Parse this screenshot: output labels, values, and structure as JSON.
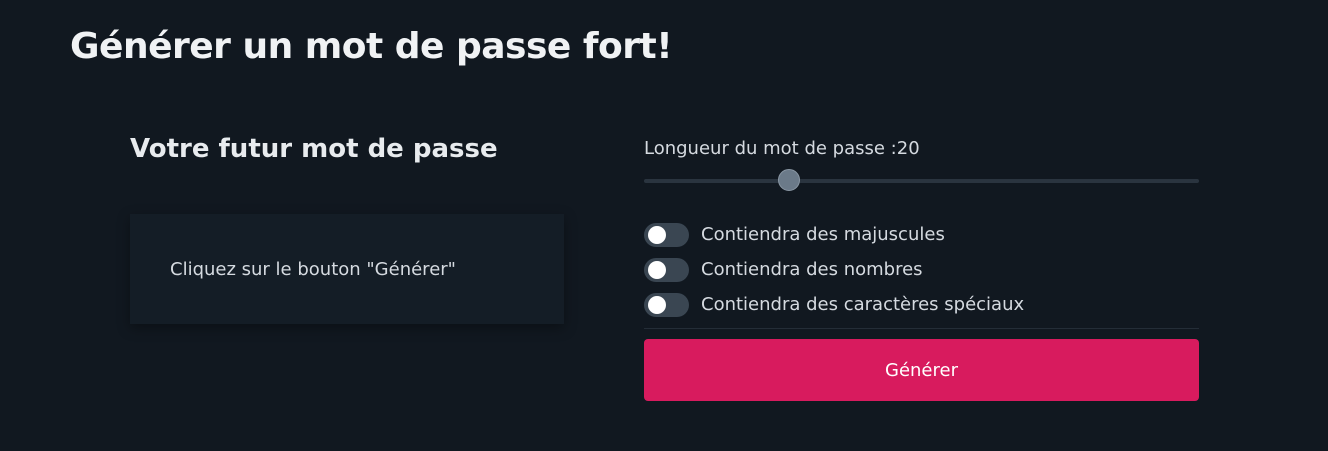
{
  "page": {
    "title": "Générer un mot de passe fort!"
  },
  "output": {
    "heading": "Votre futur mot de passe",
    "text": "Cliquez sur le bouton \"Générer\""
  },
  "options": {
    "length_label": "Longueur du mot de passe :",
    "length_value": 20,
    "toggles": [
      {
        "label": "Contiendra des majuscules",
        "checked": false
      },
      {
        "label": "Contiendra des nombres",
        "checked": false
      },
      {
        "label": "Contiendra des caractères spéciaux",
        "checked": false
      }
    ],
    "generate_label": "Générer"
  },
  "colors": {
    "background": "#111820",
    "accent": "#d81b5e",
    "output_box": "#141d26"
  }
}
